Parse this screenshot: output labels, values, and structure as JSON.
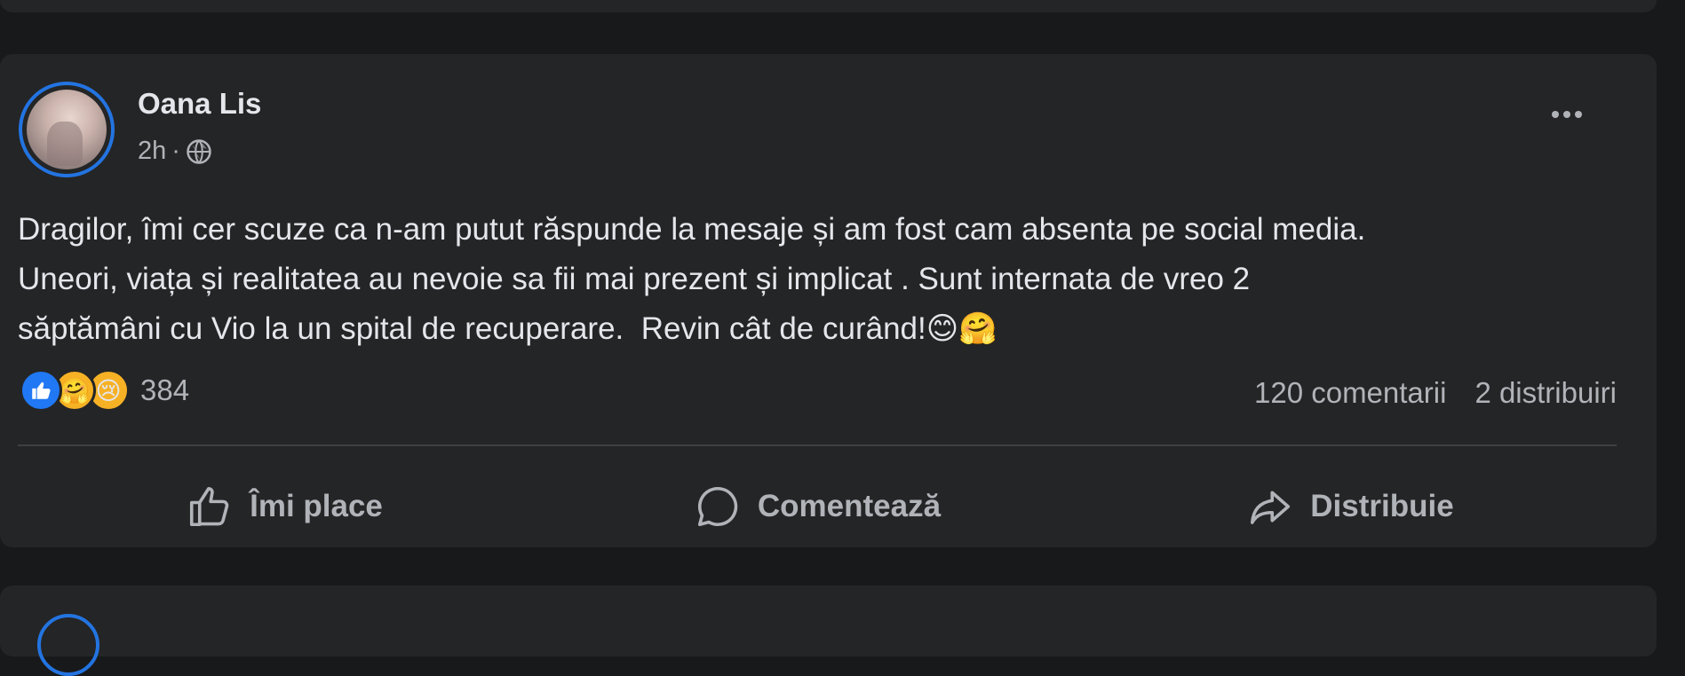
{
  "post": {
    "author": "Oana Lis",
    "time": "2h",
    "separator": "·",
    "audience_icon": "globe-icon",
    "text": "Dragilor, îmi cer scuze ca n-am putut răspunde la mesaje și am fost cam absenta pe social media.\nUneori, viața și realitatea au nevoie sa fii mai prezent și implicat . Sunt internata de vreo 2\nsăptămâni cu Vio la un spital de recuperare.  Revin cât de curând!😊🤗",
    "reactions": {
      "icons": [
        "like-reaction-icon",
        "care-reaction-icon",
        "sad-reaction-icon"
      ],
      "like_glyph": "👍",
      "care_glyph": "🤗",
      "sad_glyph": "😢",
      "count": "384"
    },
    "comments": "120 comentarii",
    "shares": "2 distribuiri"
  },
  "actions": {
    "like_label": "Îmi place",
    "comment_label": "Comentează",
    "share_label": "Distribuie"
  },
  "colors": {
    "page_bg": "#18191a",
    "card_bg": "#242526",
    "accent": "#2374e1",
    "text_primary": "#e4e6eb",
    "text_secondary": "#b0b3b8"
  }
}
